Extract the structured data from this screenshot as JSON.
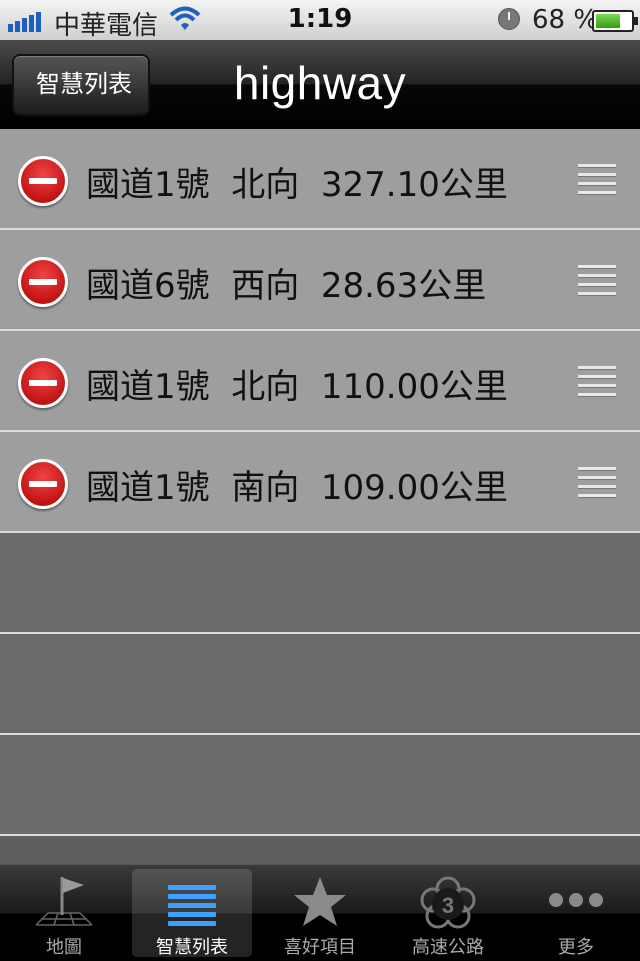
{
  "status_bar": {
    "carrier": "中華電信",
    "time": "1:19",
    "battery_percent": "68 %",
    "battery_level": 0.68
  },
  "nav": {
    "back_label": "智慧列表",
    "title": "highway"
  },
  "rows": [
    {
      "text": "國道1號  北向  327.10公里"
    },
    {
      "text": "國道6號  西向  28.63公里"
    },
    {
      "text": "國道1號  北向  110.00公里"
    },
    {
      "text": "國道1號  南向  109.00公里"
    }
  ],
  "tabs": [
    {
      "label": "地圖",
      "icon": "map-flag-icon"
    },
    {
      "label": "智慧列表",
      "icon": "list-icon"
    },
    {
      "label": "喜好項目",
      "icon": "star-icon"
    },
    {
      "label": "高速公路",
      "icon": "highway-shield-icon"
    },
    {
      "label": "更多",
      "icon": "more-icon"
    }
  ],
  "colors": {
    "delete_red": "#c40000",
    "list_bg": "#9e9e9e",
    "empty_row_bg": "#6b6b6b"
  }
}
